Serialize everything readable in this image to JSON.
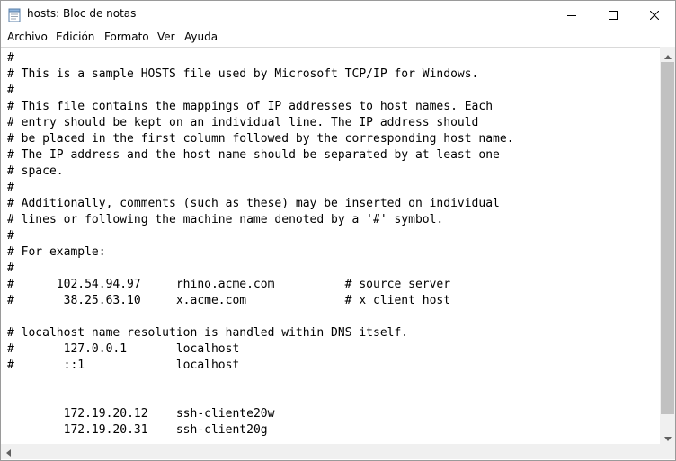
{
  "window": {
    "title": "hosts: Bloc de notas"
  },
  "menu": [
    "Archivo",
    "Edición",
    "Formato",
    "Ver",
    "Ayuda"
  ],
  "editor": {
    "content": "#\n# This is a sample HOSTS file used by Microsoft TCP/IP for Windows.\n#\n# This file contains the mappings of IP addresses to host names. Each\n# entry should be kept on an individual line. The IP address should\n# be placed in the first column followed by the corresponding host name.\n# The IP address and the host name should be separated by at least one\n# space.\n#\n# Additionally, comments (such as these) may be inserted on individual\n# lines or following the machine name denoted by a '#' symbol.\n#\n# For example:\n#\n#      102.54.94.97     rhino.acme.com          # source server\n#       38.25.63.10     x.acme.com              # x client host\n\n# localhost name resolution is handled within DNS itself.\n#\t127.0.0.1       localhost\n#\t::1             localhost\n\n\n\t172.19.20.12    ssh-cliente20w\n\t172.19.20.31    ssh-client20g"
  },
  "icons": {
    "app": "notepad-icon",
    "minimize": "minimize-icon",
    "maximize": "maximize-icon",
    "close": "close-icon"
  }
}
